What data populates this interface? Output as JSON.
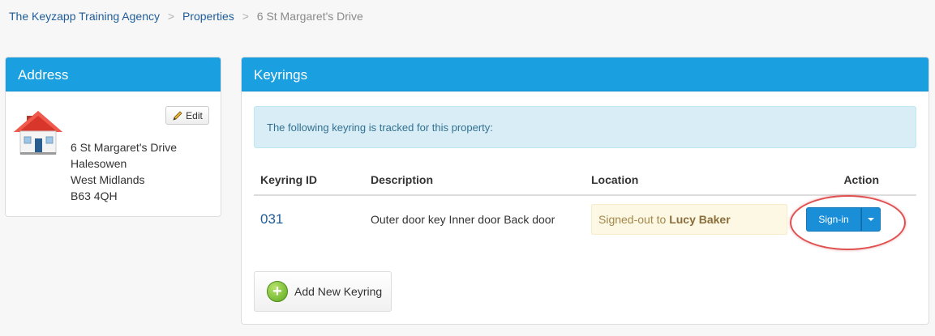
{
  "breadcrumb": {
    "items": [
      "The Keyzapp Training Agency",
      "Properties"
    ],
    "current": "6 St Margaret's Drive",
    "separator": ">"
  },
  "address_panel": {
    "title": "Address",
    "edit_label": "Edit",
    "lines": [
      "6 St Margaret's Drive",
      "Halesowen",
      "West Midlands",
      "B63 4QH"
    ]
  },
  "keyrings_panel": {
    "title": "Keyrings",
    "info": "The following keyring is tracked for this property:",
    "columns": {
      "id": "Keyring ID",
      "description": "Description",
      "location": "Location",
      "action": "Action"
    },
    "rows": [
      {
        "id": "031",
        "description": "Outer door key Inner door Back door",
        "location_prefix": "Signed-out to",
        "location_person": "Lucy Baker",
        "action_label": "Sign-in"
      }
    ],
    "add_label": "Add New Keyring"
  },
  "colors": {
    "accent": "#1a9fe0",
    "button": "#1a8fd8",
    "highlight": "#e05050"
  }
}
